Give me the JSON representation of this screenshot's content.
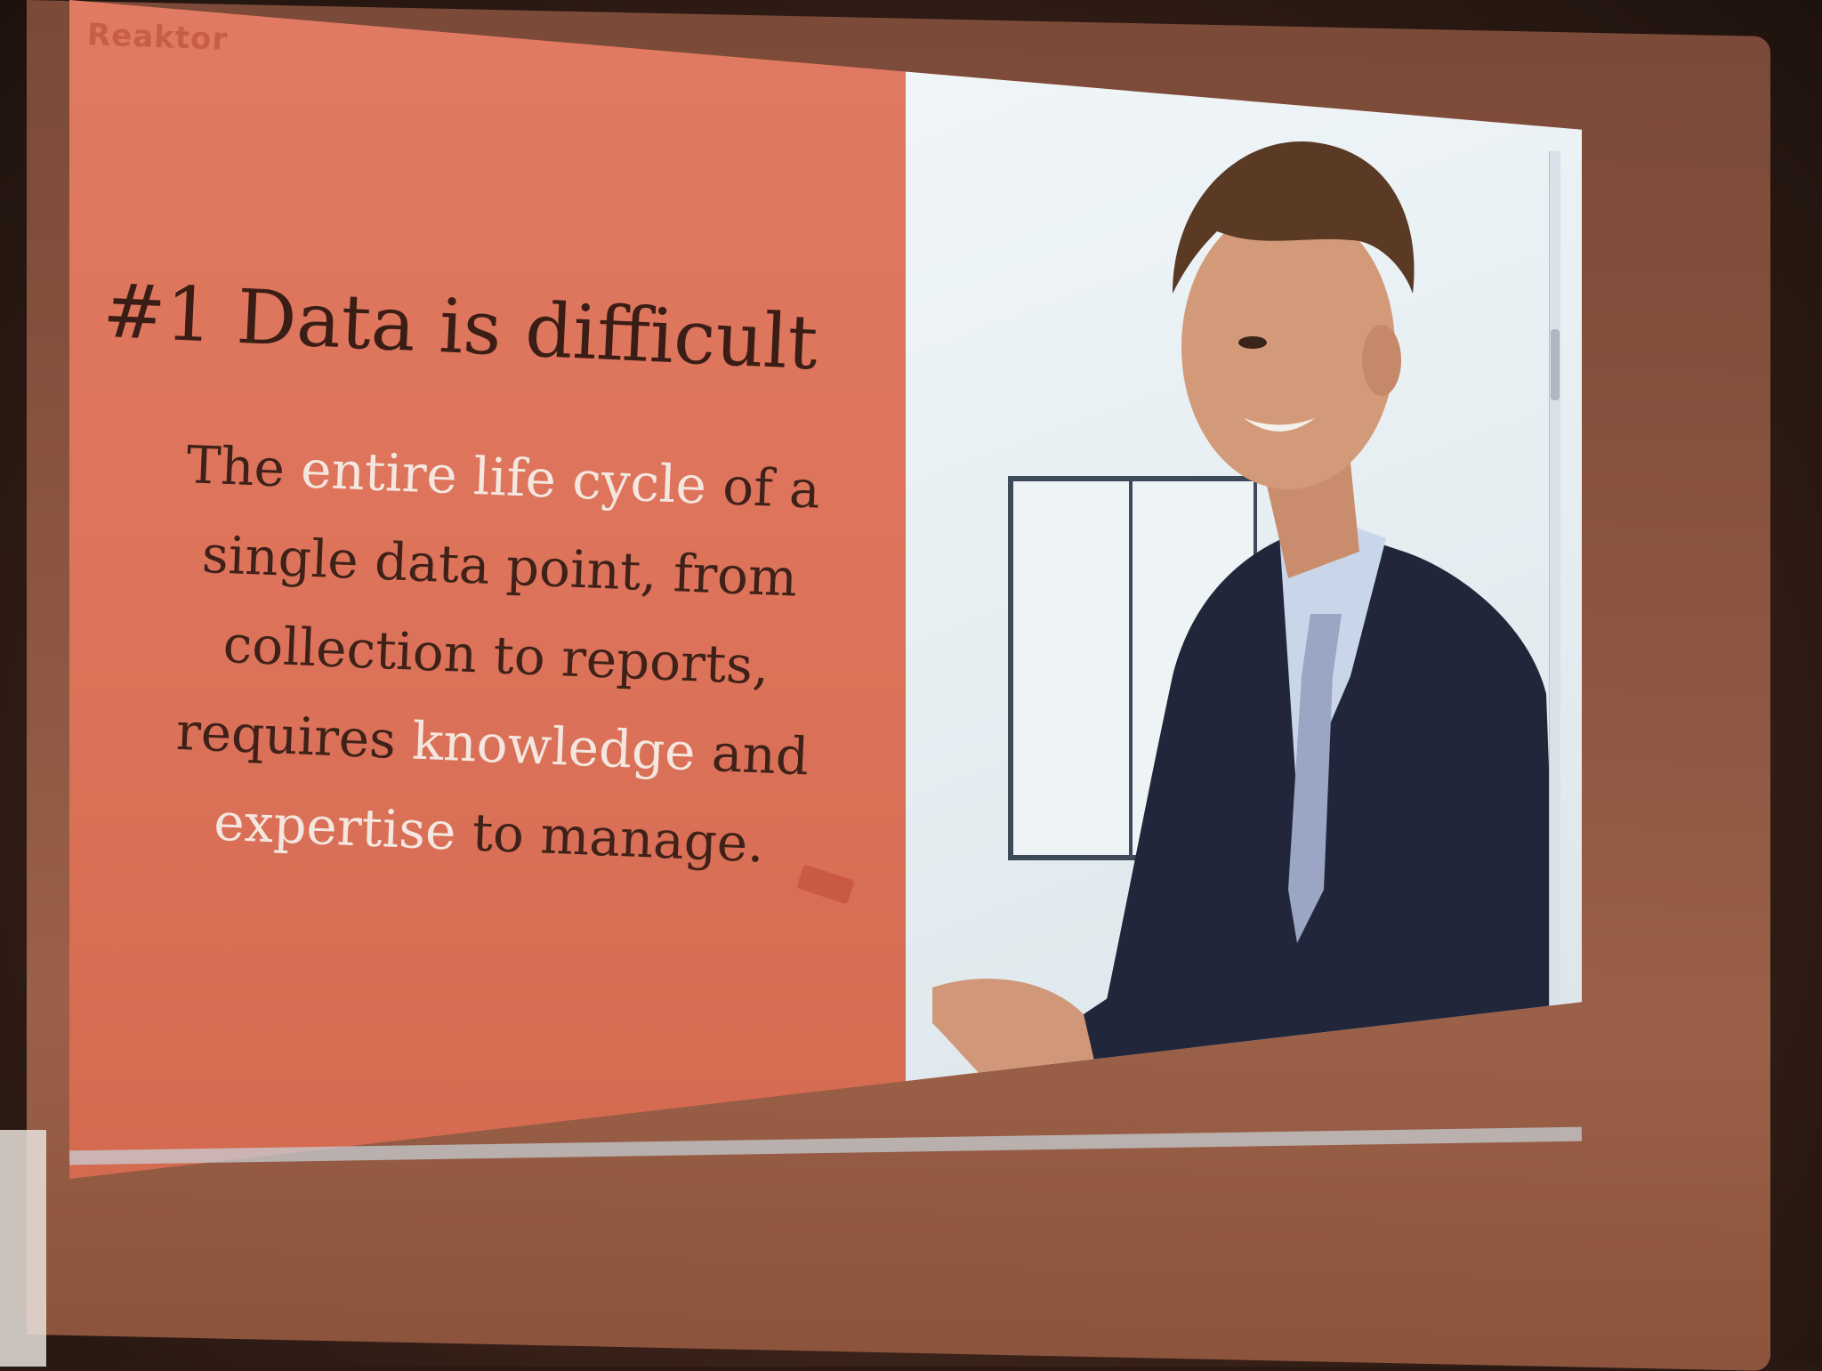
{
  "slide": {
    "brand": "Reaktor",
    "title": "#1 Data is difficult",
    "body_segments": [
      {
        "text": "The ",
        "highlight": false
      },
      {
        "text": "entire life cycle",
        "highlight": true
      },
      {
        "text": " of a single data point, from collection to reports, requires ",
        "highlight": false
      },
      {
        "text": "knowledge",
        "highlight": true
      },
      {
        "text": " and ",
        "highlight": false
      },
      {
        "text": "expertise",
        "highlight": true
      },
      {
        "text": " to manage.",
        "highlight": false
      }
    ]
  },
  "colors": {
    "slide_accent": "#dd735a",
    "title_text": "#3a1d15",
    "highlight_text": "#f4e7df",
    "photo_background": "#e6eef2"
  },
  "photo": {
    "subject_icon": "person-presenting-icon"
  }
}
